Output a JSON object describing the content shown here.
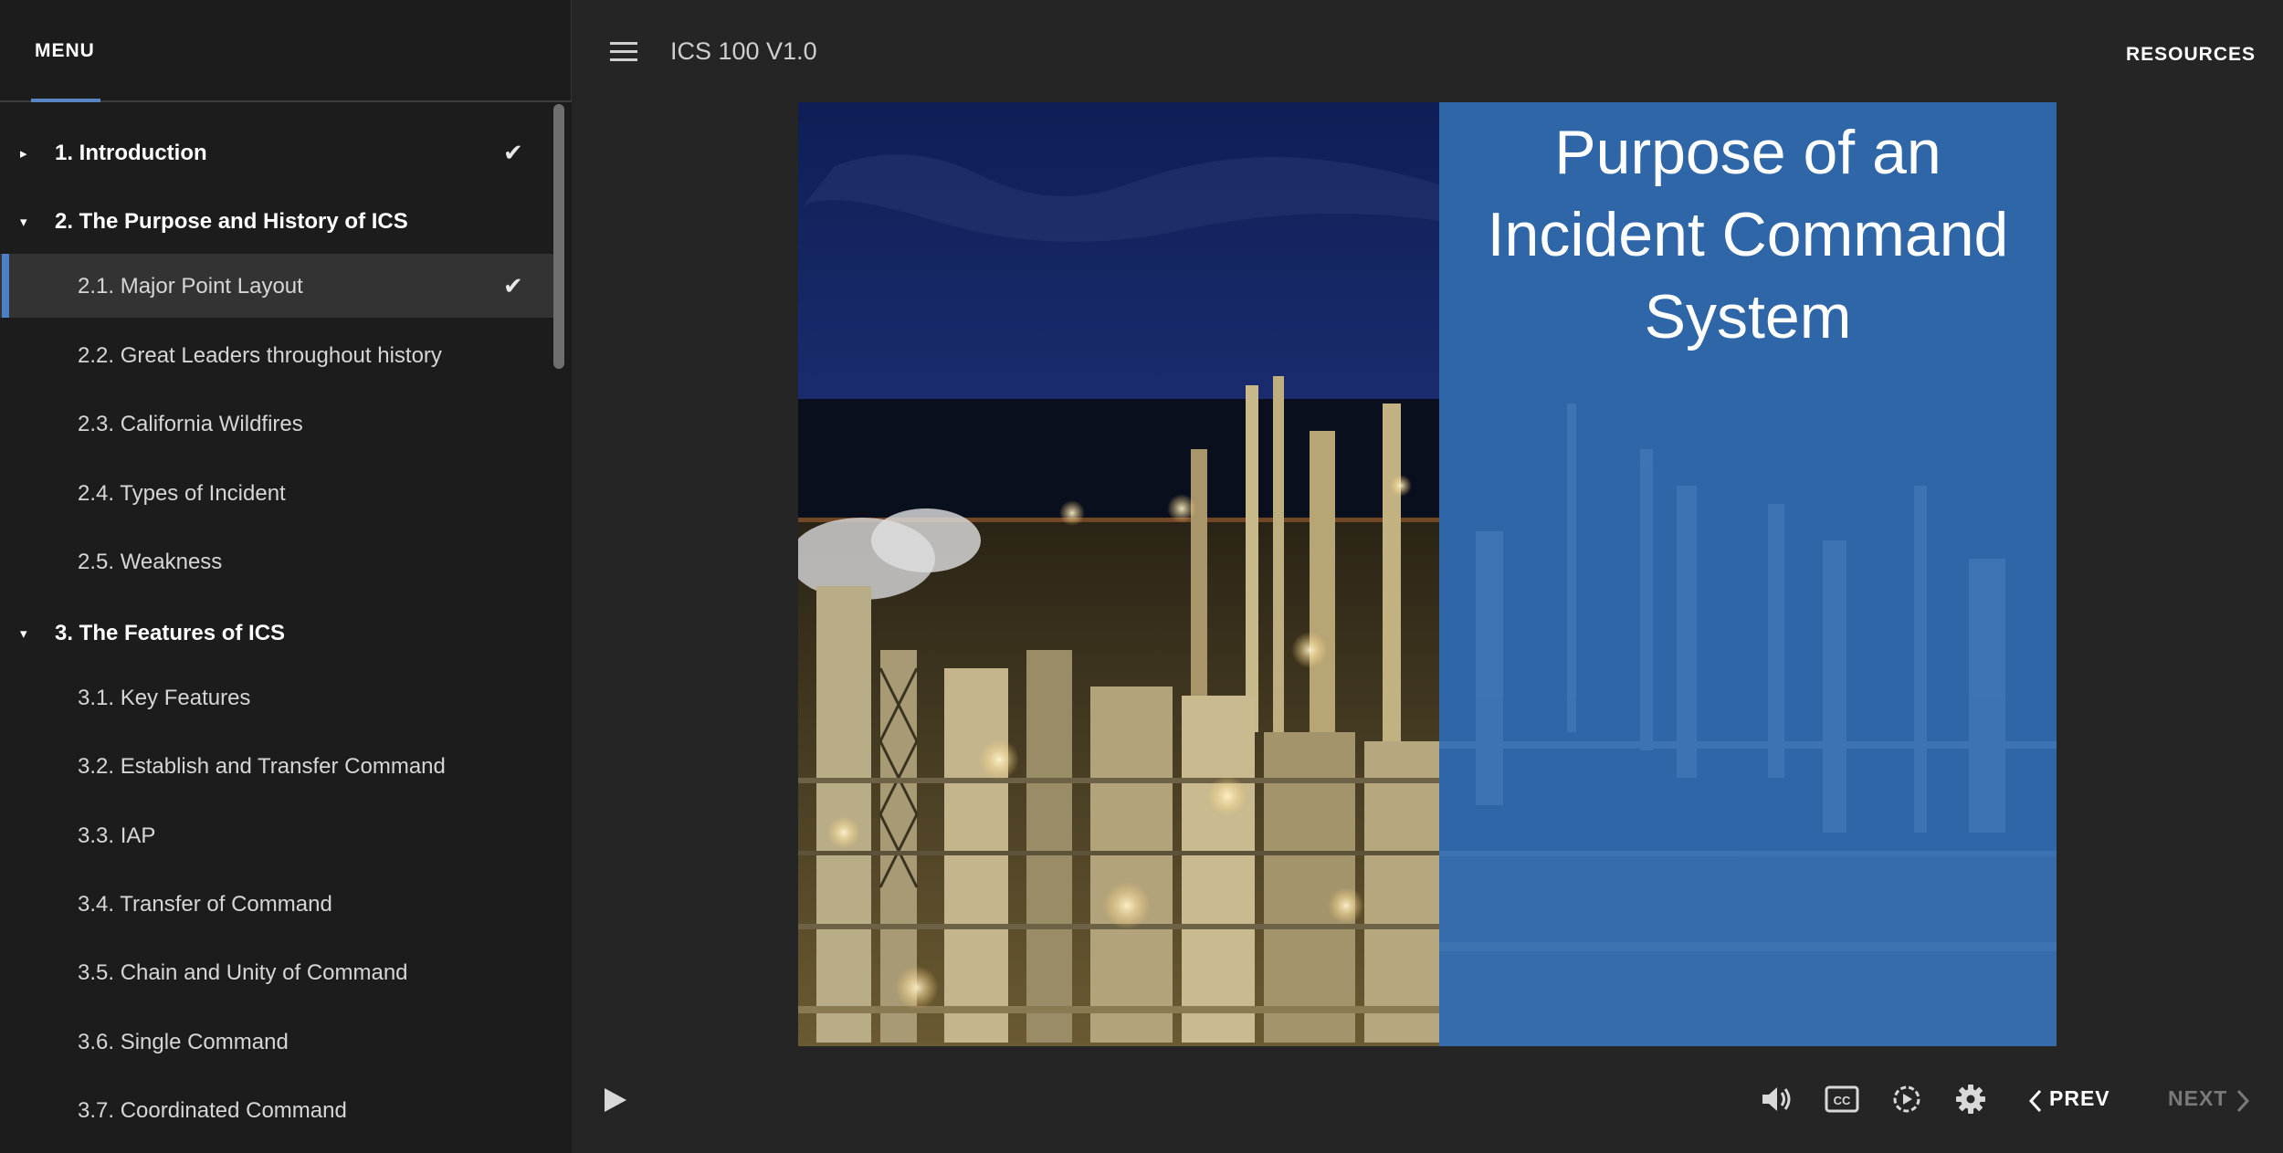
{
  "sidebar": {
    "menu_label": "MENU",
    "items": [
      {
        "label": "1. Introduction",
        "level": "section",
        "expanded": false,
        "completed": true,
        "active": false
      },
      {
        "label": "2. The Purpose and History of ICS",
        "level": "section",
        "expanded": true,
        "completed": false,
        "active": false
      },
      {
        "label": "2.1. Major Point Layout",
        "level": "sub",
        "completed": true,
        "active": true
      },
      {
        "label": "2.2. Great Leaders throughout history",
        "level": "sub",
        "completed": false,
        "active": false
      },
      {
        "label": "2.3. California Wildfires",
        "level": "sub",
        "completed": false,
        "active": false
      },
      {
        "label": "2.4. Types of Incident",
        "level": "sub",
        "completed": false,
        "active": false
      },
      {
        "label": "2.5. Weakness",
        "level": "sub",
        "completed": false,
        "active": false
      },
      {
        "label": "3. The Features of ICS",
        "level": "section",
        "expanded": true,
        "completed": false,
        "active": false
      },
      {
        "label": "3.1. Key Features",
        "level": "sub",
        "completed": false,
        "active": false
      },
      {
        "label": "3.2. Establish and Transfer Command",
        "level": "sub",
        "completed": false,
        "active": false
      },
      {
        "label": "3.3. IAP",
        "level": "sub",
        "completed": false,
        "active": false
      },
      {
        "label": "3.4. Transfer of Command",
        "level": "sub",
        "completed": false,
        "active": false
      },
      {
        "label": "3.5. Chain and Unity of Command",
        "level": "sub",
        "completed": false,
        "active": false
      },
      {
        "label": "3.6. Single Command",
        "level": "sub",
        "completed": false,
        "active": false
      },
      {
        "label": "3.7. Coordinated Command",
        "level": "sub",
        "completed": false,
        "active": false
      }
    ]
  },
  "header": {
    "course_title": "ICS 100 V1.0",
    "resources_label": "RESOURCES"
  },
  "slide": {
    "title_lines": [
      "Purpose of an",
      "Incident Command",
      "System"
    ],
    "panel_color": "#2f66a8"
  },
  "controls": {
    "prev_label": "PREV",
    "next_label": "NEXT",
    "icons": [
      "play-icon",
      "volume-icon",
      "closed-captions-icon",
      "playback-speed-icon",
      "settings-gear-icon"
    ]
  },
  "colors": {
    "accent": "#4d7fc4",
    "sidebar_bg": "#1c1c1c",
    "player_bg": "#252525"
  }
}
